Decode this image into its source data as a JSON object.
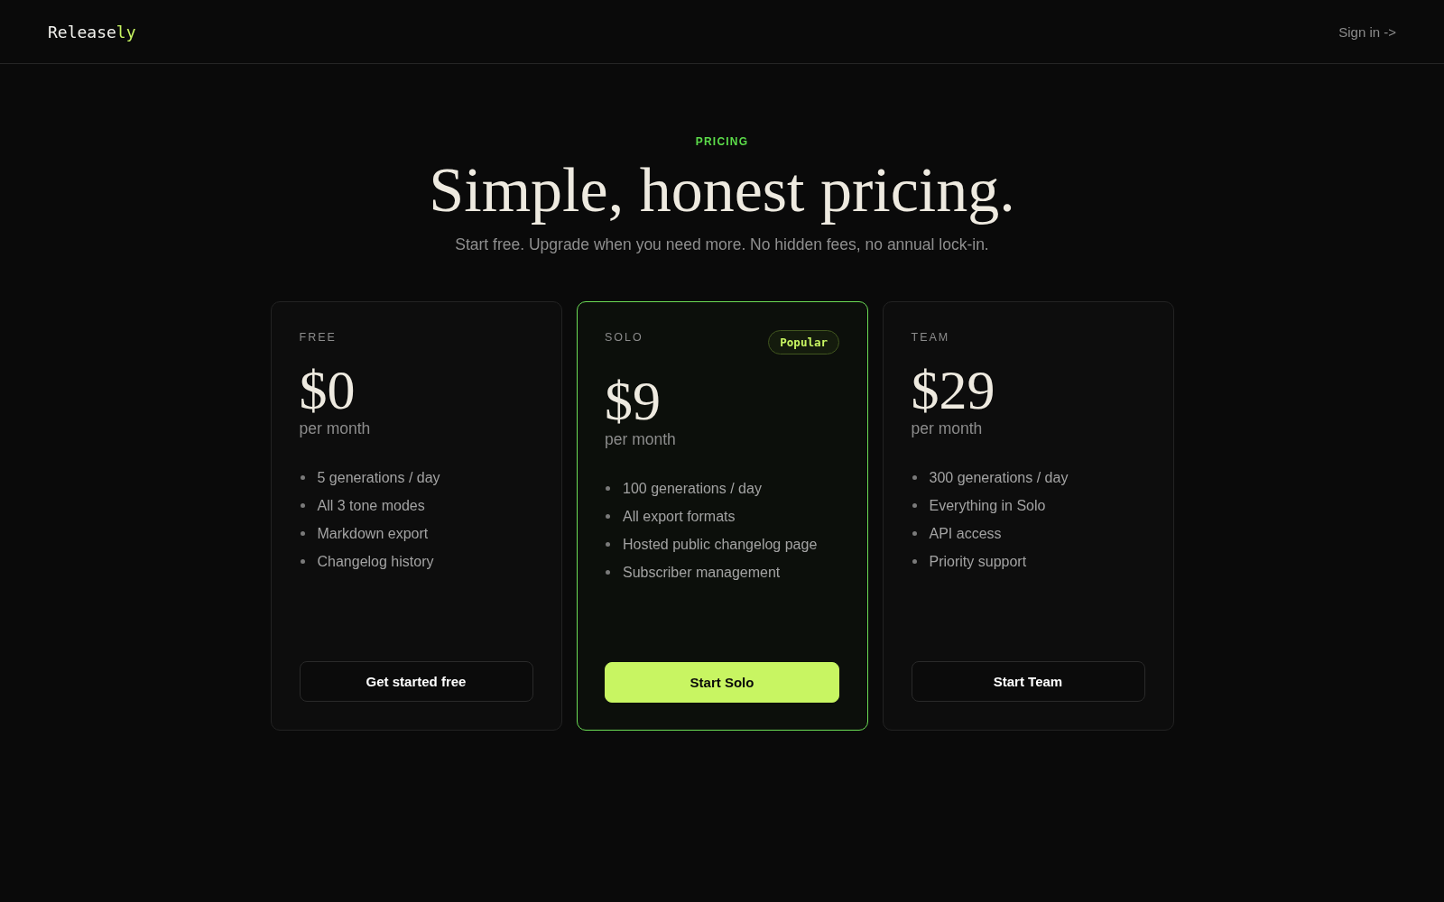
{
  "header": {
    "logo": {
      "text": "Release",
      "accent": "ly"
    },
    "sign_in": "Sign in ->"
  },
  "hero": {
    "eyebrow": "PRICING",
    "title": "Simple, honest pricing.",
    "subtitle": "Start free. Upgrade when you need more. No hidden fees, no annual lock-in."
  },
  "plans": [
    {
      "name": "FREE",
      "featured": false,
      "price": "$0",
      "period": "per month",
      "features": [
        "5 generations / day",
        "All 3 tone modes",
        "Markdown export",
        "Changelog history"
      ],
      "cta": "Get started free"
    },
    {
      "name": "SOLO",
      "featured": true,
      "badge": "Popular",
      "price": "$9",
      "period": "per month",
      "features": [
        "100 generations / day",
        "All export formats",
        "Hosted public changelog page",
        "Subscriber management"
      ],
      "cta": "Start Solo"
    },
    {
      "name": "TEAM",
      "featured": false,
      "price": "$29",
      "period": "per month",
      "features": [
        "300 generations / day",
        "Everything in Solo",
        "API access",
        "Priority support"
      ],
      "cta": "Start Team"
    }
  ]
}
